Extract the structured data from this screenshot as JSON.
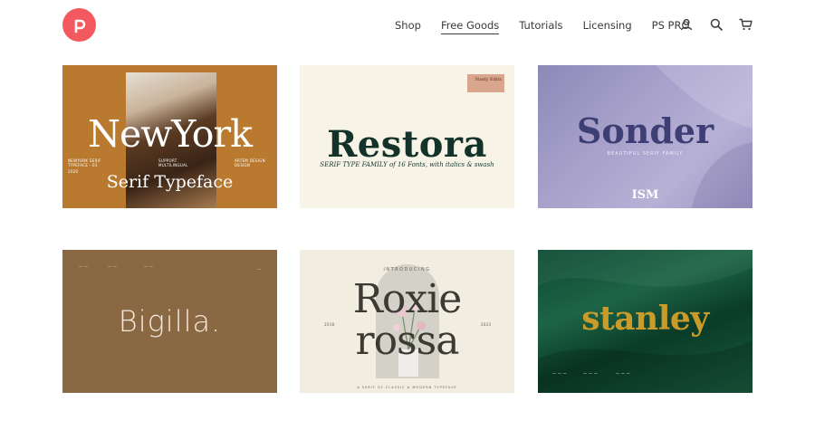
{
  "nav": {
    "links": [
      "Shop",
      "Free Goods",
      "Tutorials",
      "Licensing",
      "PS PRO"
    ],
    "active": "Free Goods"
  },
  "icons": {
    "logo": "pixelsurplus-logo",
    "account": "user-icon",
    "search": "search-icon",
    "cart": "cart-icon"
  },
  "colors": {
    "brand": "#f25a5f"
  },
  "cards": [
    {
      "title": "NewYork",
      "subtitle": "Serif Typeface",
      "notes": [
        "NEWYORK SERIF TYPEFACE - 01",
        "2020",
        "SUPPORT MULTILINGUAL",
        "ARTEM DESIGN DESIGN"
      ]
    },
    {
      "title": "Restora",
      "subtitle": "SERIF TYPE FAMILY of 16 Fonts, with italics & swash",
      "badge": "Nasty Edits"
    },
    {
      "title": "Sonder",
      "subtitle": "BEAUTIFUL SERIF FAMILY",
      "monogram": "ISM"
    },
    {
      "title": "Bigilla."
    },
    {
      "title_line1": "Roxie",
      "title_line2": "rossa",
      "intro": "INTRODUCING",
      "year_left": "2018",
      "year_right": "2023",
      "footer": "A SERIF OF CLASSIC & MODERN TYPEFACE"
    },
    {
      "title": "stanley"
    }
  ]
}
